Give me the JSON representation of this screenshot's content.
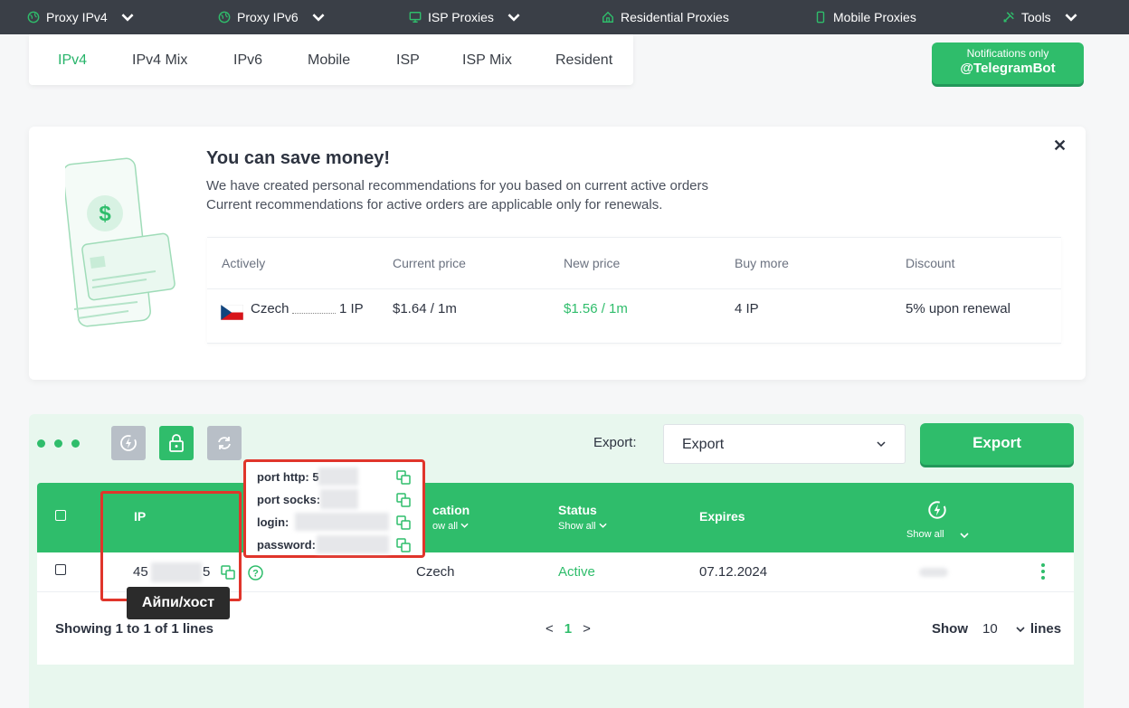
{
  "topnav": {
    "items": [
      {
        "label": "Proxy IPv4",
        "icon": "globe-icon",
        "dropdown": true
      },
      {
        "label": "Proxy IPv6",
        "icon": "globe-icon",
        "dropdown": true
      },
      {
        "label": "ISP Proxies",
        "icon": "monitor-icon",
        "dropdown": true
      },
      {
        "label": "Residential Proxies",
        "icon": "home-icon",
        "dropdown": false
      },
      {
        "label": "Mobile Proxies",
        "icon": "phone-icon",
        "dropdown": false
      },
      {
        "label": "Tools",
        "icon": "tools-icon",
        "dropdown": true
      }
    ]
  },
  "tabs": [
    {
      "label": "IPv4",
      "active": true
    },
    {
      "label": "IPv4 Mix",
      "active": false
    },
    {
      "label": "IPv6",
      "active": false
    },
    {
      "label": "Mobile",
      "active": false
    },
    {
      "label": "ISP",
      "active": false
    },
    {
      "label": "ISP Mix",
      "active": false
    },
    {
      "label": "Resident",
      "active": false
    }
  ],
  "telegram": {
    "small": "Notifications only",
    "big": "@TelegramBot"
  },
  "recommendation": {
    "title": "You can save money!",
    "line1": "We have created personal recommendations for you based on current active orders",
    "line2": "Current recommendations for active orders are applicable only for renewals.",
    "headers": [
      "Actively",
      "Current price",
      "New price",
      "Buy more",
      "Discount"
    ],
    "row": {
      "country": "Czech",
      "qty": "1 IP",
      "current_price": "$1.64 / 1m",
      "new_price": "$1.56 / 1m",
      "buy_more": "4 IP",
      "discount": "5% upon renewal"
    }
  },
  "orders": {
    "export_label": "Export:",
    "export_select": "Export",
    "export_button": "Export",
    "headers": {
      "ip": "IP",
      "location": "cation",
      "location_sub": "ow all",
      "status": "Status",
      "status_sub": "Show all",
      "expires": "Expires",
      "auto_sub": "Show all"
    },
    "row": {
      "ip_start": "45",
      "ip_end": "5",
      "location": "Czech",
      "status": "Active",
      "expires": "07.12.2024"
    },
    "footer": {
      "showing": "Showing 1 to 1 of 1 lines",
      "prev": "<",
      "page": "1",
      "next": ">",
      "show": "Show",
      "per_page": "10",
      "lines": "lines"
    }
  },
  "popup": {
    "port_http": "port http: 5",
    "port_socks": "port socks:",
    "login": "login:",
    "password": "password:"
  },
  "tooltip": "Айпи/хост",
  "colors": {
    "accent": "#2fbd6b",
    "nav": "#3a3f47",
    "highlight": "#e0352b"
  }
}
